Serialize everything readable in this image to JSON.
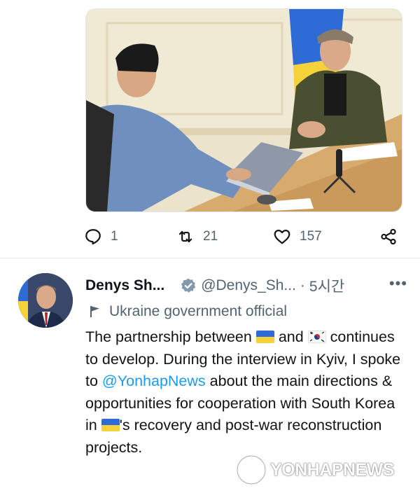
{
  "tweet_top": {
    "stats": {
      "replies": "1",
      "retweets": "21",
      "likes": "157"
    }
  },
  "tweet": {
    "name": "Denys Sh...",
    "handle": "@Denys_Sh...",
    "separator": "·",
    "time": "5시간",
    "more": "•••",
    "label": "Ukraine government official",
    "text": {
      "p1": "The partnership between",
      "p2": "and",
      "p3": "continues to develop. During the interview in Kyiv, I spoke to",
      "mention": "@YonhapNews",
      "p4": "about the main directions & opportunities for cooperation with South Korea in",
      "p5": "'s recovery and post-war reconstruction projects."
    }
  },
  "watermark": {
    "text": "YONHAPNEWS"
  },
  "colors": {
    "accent": "#1d9bf0",
    "muted": "#536471",
    "verified": "#829aab"
  },
  "icons": [
    "reply-icon",
    "retweet-icon",
    "like-icon",
    "share-icon",
    "verified-icon",
    "flag-label-icon"
  ]
}
